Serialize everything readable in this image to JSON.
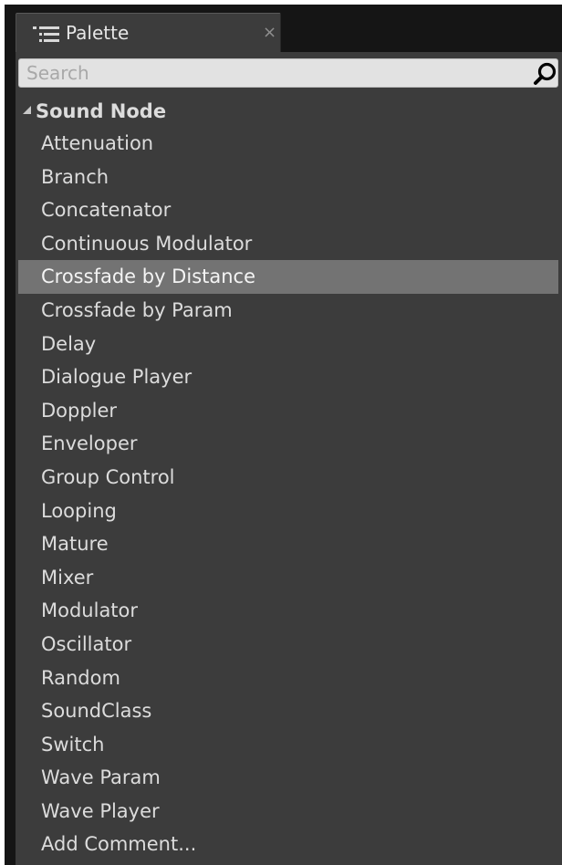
{
  "tab": {
    "title": "Palette",
    "icon": "palette-list-icon",
    "close_glyph": "×"
  },
  "search": {
    "value": "",
    "placeholder": "Search",
    "icon": "search-icon"
  },
  "category": {
    "label": "Sound Node",
    "expanded": true,
    "icon": "expanded-triangle-icon"
  },
  "items": [
    {
      "label": "Attenuation",
      "selected": false
    },
    {
      "label": "Branch",
      "selected": false
    },
    {
      "label": "Concatenator",
      "selected": false
    },
    {
      "label": "Continuous Modulator",
      "selected": false
    },
    {
      "label": "Crossfade by Distance",
      "selected": true
    },
    {
      "label": "Crossfade by Param",
      "selected": false
    },
    {
      "label": "Delay",
      "selected": false
    },
    {
      "label": "Dialogue Player",
      "selected": false
    },
    {
      "label": "Doppler",
      "selected": false
    },
    {
      "label": "Enveloper",
      "selected": false
    },
    {
      "label": "Group Control",
      "selected": false
    },
    {
      "label": "Looping",
      "selected": false
    },
    {
      "label": "Mature",
      "selected": false
    },
    {
      "label": "Mixer",
      "selected": false
    },
    {
      "label": "Modulator",
      "selected": false
    },
    {
      "label": "Oscillator",
      "selected": false
    },
    {
      "label": "Random",
      "selected": false
    },
    {
      "label": "SoundClass",
      "selected": false
    },
    {
      "label": "Switch",
      "selected": false
    },
    {
      "label": "Wave Param",
      "selected": false
    },
    {
      "label": "Wave Player",
      "selected": false
    },
    {
      "label": "Add Comment...",
      "selected": false
    }
  ],
  "colors": {
    "frame_background": "#151515",
    "panel_background": "#3c3c3c",
    "selection_highlight": "#737373",
    "text": "#dcdcdc",
    "search_background": "#e2e2e2"
  }
}
